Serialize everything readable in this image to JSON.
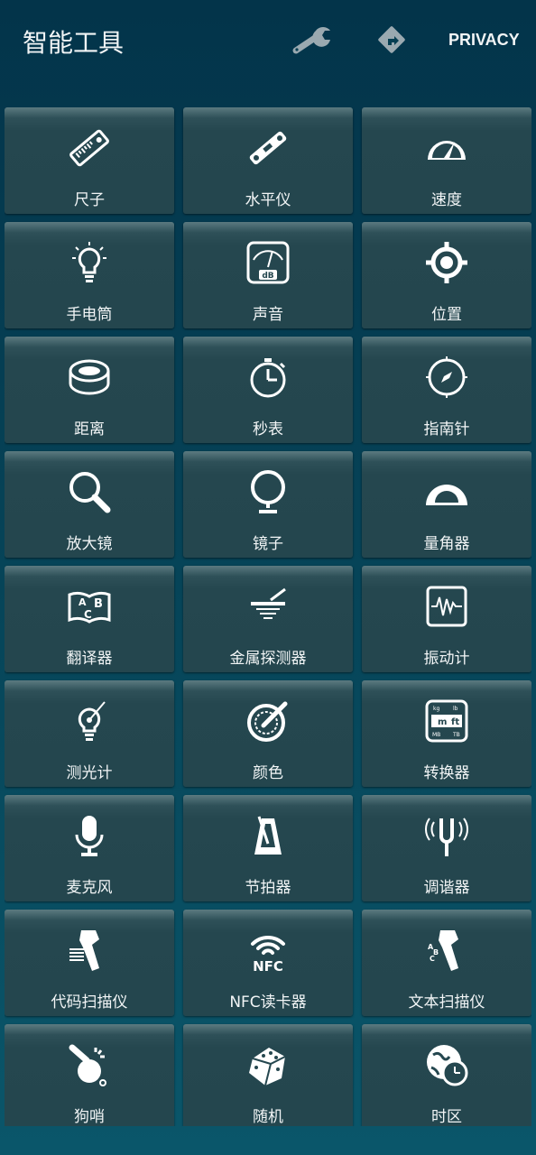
{
  "header": {
    "title": "智能工具",
    "settings_icon": "wrench-icon",
    "direction_icon": "directions-icon",
    "privacy_label": "PRIVACY"
  },
  "colors": {
    "background": "#053e52",
    "tile": "#25474f",
    "text": "#f2f5f6",
    "header_icons": "#9aa9b0"
  },
  "tools": [
    {
      "label": "尺子",
      "icon": "ruler-icon"
    },
    {
      "label": "水平仪",
      "icon": "spirit-level-icon"
    },
    {
      "label": "速度",
      "icon": "speedometer-icon"
    },
    {
      "label": "手电筒",
      "icon": "flashlight-bulb-icon"
    },
    {
      "label": "声音",
      "icon": "sound-meter-icon"
    },
    {
      "label": "位置",
      "icon": "location-icon"
    },
    {
      "label": "距离",
      "icon": "tape-measure-icon"
    },
    {
      "label": "秒表",
      "icon": "stopwatch-icon"
    },
    {
      "label": "指南针",
      "icon": "compass-icon"
    },
    {
      "label": "放大镜",
      "icon": "magnifier-icon"
    },
    {
      "label": "镜子",
      "icon": "mirror-icon"
    },
    {
      "label": "量角器",
      "icon": "protractor-icon"
    },
    {
      "label": "翻译器",
      "icon": "translator-icon"
    },
    {
      "label": "金属探测器",
      "icon": "metal-detector-icon"
    },
    {
      "label": "振动计",
      "icon": "vibration-meter-icon"
    },
    {
      "label": "测光计",
      "icon": "light-meter-icon"
    },
    {
      "label": "颜色",
      "icon": "color-picker-icon"
    },
    {
      "label": "转换器",
      "icon": "unit-converter-icon"
    },
    {
      "label": "麦克风",
      "icon": "microphone-icon"
    },
    {
      "label": "节拍器",
      "icon": "metronome-icon"
    },
    {
      "label": "调谐器",
      "icon": "tuning-fork-icon"
    },
    {
      "label": "代码扫描仪",
      "icon": "barcode-scanner-icon"
    },
    {
      "label": "NFC读卡器",
      "icon": "nfc-icon"
    },
    {
      "label": "文本扫描仪",
      "icon": "text-scanner-icon"
    },
    {
      "label": "狗哨",
      "icon": "whistle-icon"
    },
    {
      "label": "随机",
      "icon": "dice-icon"
    },
    {
      "label": "时区",
      "icon": "time-zone-icon"
    }
  ]
}
